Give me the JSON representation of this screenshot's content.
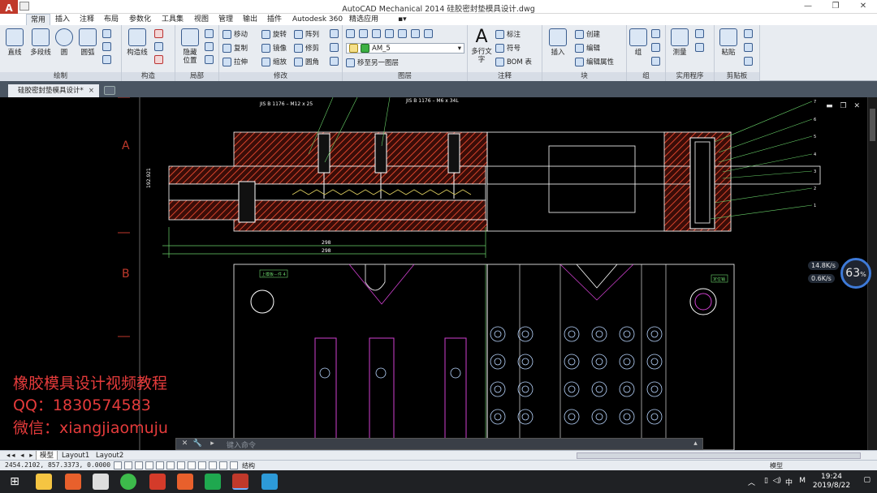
{
  "app": {
    "title": "AutoCAD Mechanical 2014    硅胶密封垫模具设计.dwg",
    "logo_letter": "A"
  },
  "ribbon_tabs": [
    "常用",
    "插入",
    "注释",
    "布局",
    "参数化",
    "工具集",
    "视图",
    "管理",
    "输出",
    "插件",
    "Autodesk 360",
    "精选应用"
  ],
  "ribbon": {
    "draw": {
      "label": "绘制",
      "line": "直线",
      "polyline": "多段线",
      "circle": "圆",
      "arc": "圆弧"
    },
    "construct": {
      "label": "构造",
      "construct_line": "构造线"
    },
    "detail": {
      "label": "局部",
      "hide": "隐藏",
      "position": "位置"
    },
    "modify": {
      "label": "修改",
      "move": "移动",
      "rotate": "旋转",
      "array": "阵列",
      "copy": "复制",
      "mirror": "镜像",
      "trim": "修剪",
      "stretch": "拉伸",
      "scale": "缩放",
      "fillet": "圆角"
    },
    "layers": {
      "label": "图层",
      "current_layer": "AM_5",
      "move_to_layer": "移至另一图层"
    },
    "annotation": {
      "label": "注释",
      "text": "多行文字",
      "dimension": "标注",
      "symbol": "符号",
      "bom": "BOM 表"
    },
    "block": {
      "label": "块",
      "insert": "插入",
      "create": "创建",
      "edit": "编辑",
      "edit_attr": "编辑属性"
    },
    "group": {
      "label": "组",
      "group": "组"
    },
    "utilities": {
      "label": "实用程序",
      "measure": "测量"
    },
    "clipboard": {
      "label": "剪贴板",
      "paste": "粘贴"
    }
  },
  "document_tab": "硅胶密封垫模具设计*",
  "drawing": {
    "row_labels": [
      "A",
      "B"
    ],
    "annotations": [
      "JIS B 1176 – M12 x 25",
      "JIS B 1176 – M6 x 34L",
      "298",
      "298",
      "192.921"
    ],
    "leader_numbers": [
      "7",
      "6",
      "5",
      "4",
      "3",
      "2",
      "1"
    ],
    "tags": [
      "上模板－件 4",
      "定位销"
    ]
  },
  "watermark": {
    "line1": "橡胶模具设计视频教程",
    "line2": "QQ：1830574583",
    "line3": "微信：xiangjiaomuju"
  },
  "net_widget": {
    "percent": "63",
    "percent_unit": "%",
    "upload": "14.8K/s",
    "download": "0.6K/s"
  },
  "command": {
    "placeholder": "键入命令"
  },
  "layout_tabs": [
    "模型",
    "Layout1",
    "Layout2"
  ],
  "status": {
    "coords": "2454.2102, 857.3373, 0.0000",
    "structure": "结构",
    "model": "模型"
  },
  "taskbar": {
    "time": "19:24",
    "date": "2019/8/22",
    "ime": "中",
    "ime2": "M"
  }
}
